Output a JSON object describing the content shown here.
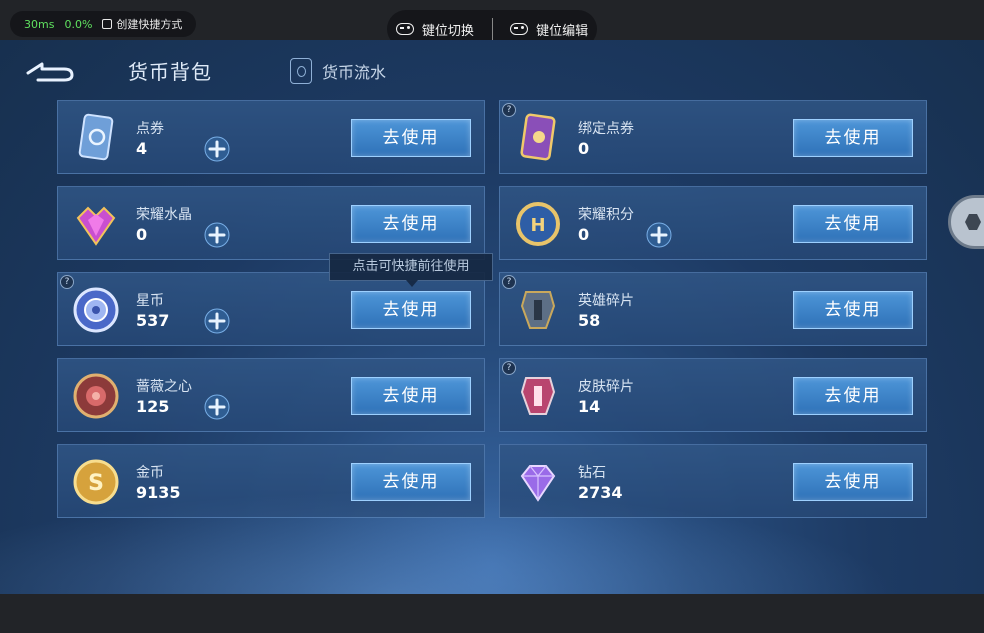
{
  "perf": {
    "latency": "30ms",
    "cpu": "0.0%",
    "shortcut_label": "创建快捷方式"
  },
  "key_controls": {
    "switch_label": "键位切换",
    "edit_label": "键位编辑"
  },
  "header": {
    "active_tab": "货币背包",
    "ledger_tab": "货币流水"
  },
  "tooltip": "点击可快捷前往使用",
  "use_label": "去使用",
  "currencies": [
    {
      "name": "点券",
      "value": "4",
      "has_plus": true,
      "has_help": false,
      "icon": "coupon-card-icon"
    },
    {
      "name": "绑定点券",
      "value": "0",
      "has_plus": false,
      "has_help": true,
      "icon": "bound-coupon-card-icon"
    },
    {
      "name": "荣耀水晶",
      "value": "0",
      "has_plus": true,
      "has_help": false,
      "icon": "glory-crystal-icon"
    },
    {
      "name": "荣耀积分",
      "value": "0",
      "has_plus": true,
      "has_help": false,
      "icon": "glory-points-icon"
    },
    {
      "name": "星币",
      "value": "537",
      "has_plus": true,
      "has_help": true,
      "icon": "star-coin-icon"
    },
    {
      "name": "英雄碎片",
      "value": "58",
      "has_plus": false,
      "has_help": true,
      "icon": "hero-fragment-icon"
    },
    {
      "name": "蔷薇之心",
      "value": "125",
      "has_plus": true,
      "has_help": false,
      "icon": "rose-heart-icon"
    },
    {
      "name": "皮肤碎片",
      "value": "14",
      "has_plus": false,
      "has_help": true,
      "icon": "skin-fragment-icon"
    },
    {
      "name": "金币",
      "value": "9135",
      "has_plus": false,
      "has_help": false,
      "icon": "gold-coin-icon"
    },
    {
      "name": "钻石",
      "value": "2734",
      "has_plus": false,
      "has_help": false,
      "icon": "diamond-icon"
    }
  ]
}
